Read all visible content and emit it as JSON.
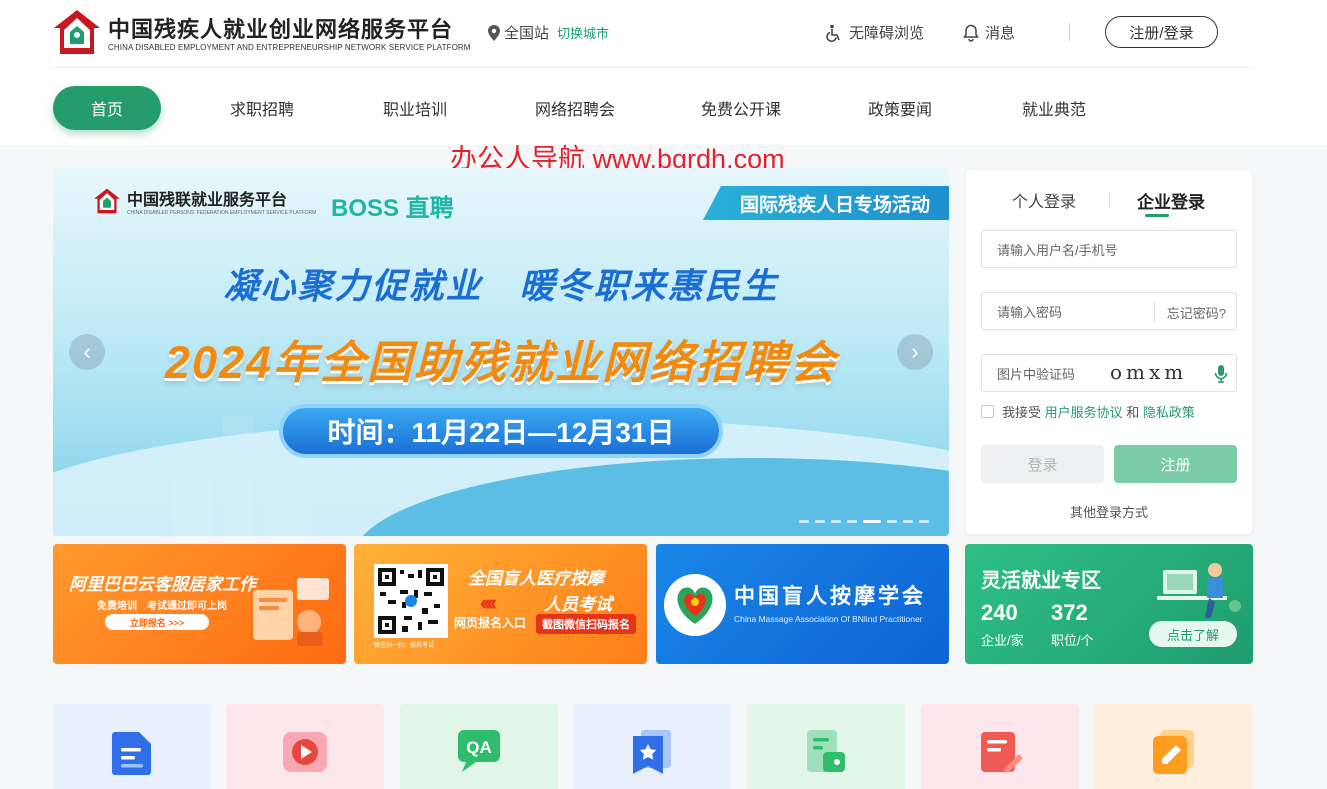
{
  "header": {
    "title": "中国残疾人就业创业网络服务平台",
    "subtitle": "CHINA DISABLED EMPLOYMENT AND ENTREPRENEURSHIP NETWORK SERVICE PLATFORM",
    "location": "全国站",
    "switch_city": "切换城市",
    "accessibility": "无障碍浏览",
    "messages": "消息",
    "register_login": "注册/登录"
  },
  "nav": [
    "首页",
    "求职招聘",
    "职业培训",
    "网络招聘会",
    "免费公开课",
    "政策要闻",
    "就业典范"
  ],
  "watermark": "办公人导航 www.bgrdh.com",
  "banner": {
    "logo_text": "中国残联就业服务平台",
    "logo_en": "CHINA DISABLED PERSONS' FEDERATION EMPLOYMENT SERVICE PLATFORM",
    "partner": "BOSS 直聘",
    "ribbon": "国际残疾人日专场活动",
    "slogan": "凝心聚力促就业　暖冬职来惠民生",
    "headline": "2024年全国助残就业网络招聘会",
    "time": "时间：11月22日—12月31日",
    "prev": "‹",
    "next": "›",
    "slides_total": 8,
    "slide_active": 5
  },
  "login": {
    "tab_personal": "个人登录",
    "tab_enterprise": "企业登录",
    "username_placeholder": "请输入用户名/手机号",
    "password_placeholder": "请输入密码",
    "forgot": "忘记密码?",
    "captcha_placeholder": "图片中验证码",
    "captcha_text": "omxm",
    "agree_prefix": "我接受",
    "agree_terms": "用户服务协议",
    "agree_and": "和",
    "agree_privacy": "隐私政策",
    "login_btn": "登录",
    "register_btn": "注册",
    "other_methods": "其他登录方式"
  },
  "promos": {
    "alibaba": {
      "title": "阿里巴巴云客服居家工作",
      "sub": "免费培训　考试通过即可上岗",
      "btn": "立即报名 >>>"
    },
    "blind_massage": {
      "qr_caption": "微信扫一扫，报名考试",
      "t1": "全国盲人医疗按摩",
      "t2": "人员考试",
      "web": "网页报名入口",
      "scan": "截图微信扫码报名"
    },
    "association": {
      "cn": "中国盲人按摩学会",
      "en": "China Massage Association Of BNlind Practitioner"
    },
    "flexible": {
      "title": "灵活就业专区",
      "companies": "240",
      "companies_label": "企业/家",
      "positions": "372",
      "positions_label": "职位/个",
      "btn": "点击了解"
    }
  },
  "colors": {
    "brand": "#259c6c",
    "accent_red": "#e0242f"
  }
}
